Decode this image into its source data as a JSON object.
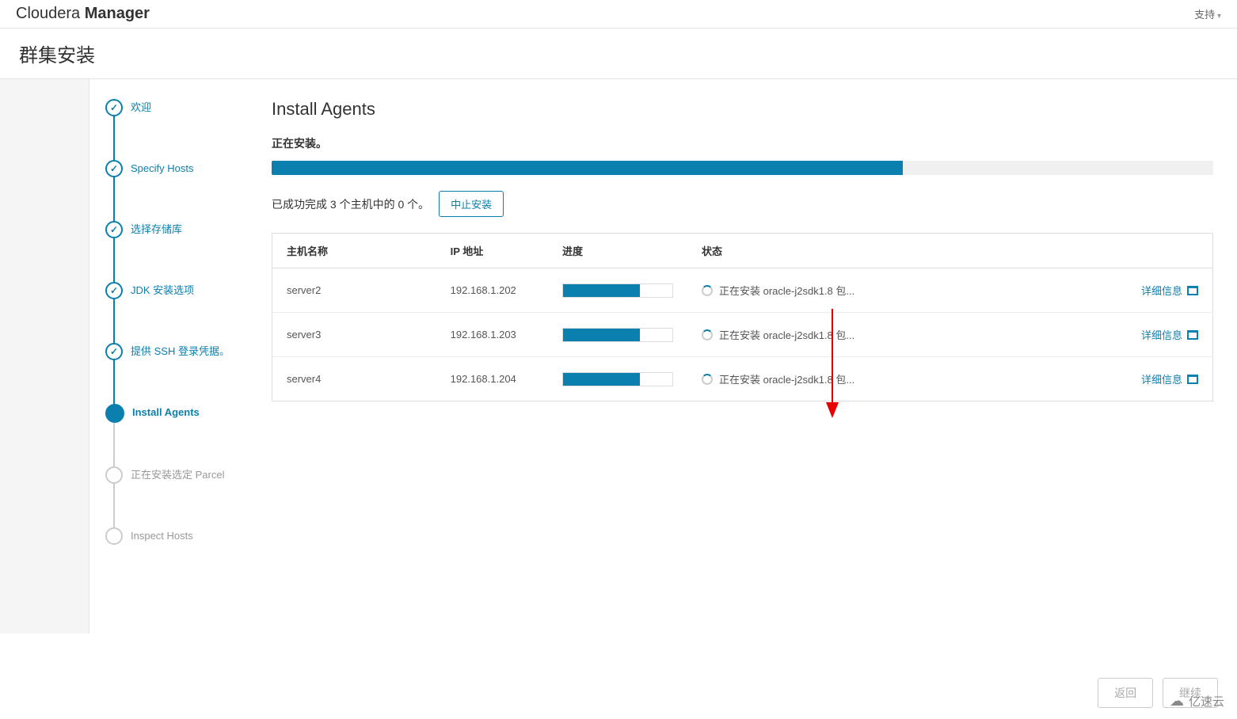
{
  "header": {
    "logo_prefix": "Cloudera ",
    "logo_bold": "Manager",
    "support": "支持"
  },
  "subheader": {
    "title": "群集安装"
  },
  "wizard": {
    "steps": [
      {
        "label": "欢迎",
        "state": "completed"
      },
      {
        "label": "Specify Hosts",
        "state": "completed"
      },
      {
        "label": "选择存储库",
        "state": "completed"
      },
      {
        "label": "JDK 安装选项",
        "state": "completed"
      },
      {
        "label": "提供 SSH 登录凭据。",
        "state": "completed"
      },
      {
        "label": "Install Agents",
        "state": "active"
      },
      {
        "label": "正在安装选定 Parcel",
        "state": "pending"
      },
      {
        "label": "Inspect Hosts",
        "state": "pending"
      }
    ]
  },
  "main": {
    "title": "Install Agents",
    "status": "正在安装。",
    "overall_progress_percent": 67,
    "progress_text": "已成功完成 3 个主机中的 0 个。",
    "abort_button": "中止安装",
    "table": {
      "headers": {
        "host": "主机名称",
        "ip": "IP 地址",
        "progress": "进度",
        "status": "状态"
      },
      "rows": [
        {
          "host": "server2",
          "ip": "192.168.1.202",
          "progress": 70,
          "status": "正在安装 oracle-j2sdk1.8 包...",
          "detail": "详细信息"
        },
        {
          "host": "server3",
          "ip": "192.168.1.203",
          "progress": 70,
          "status": "正在安装 oracle-j2sdk1.8 包...",
          "detail": "详细信息"
        },
        {
          "host": "server4",
          "ip": "192.168.1.204",
          "progress": 70,
          "status": "正在安装 oracle-j2sdk1.8 包...",
          "detail": "详细信息"
        }
      ]
    }
  },
  "footer": {
    "back": "返回",
    "continue": "继续"
  },
  "watermark": "亿速云"
}
